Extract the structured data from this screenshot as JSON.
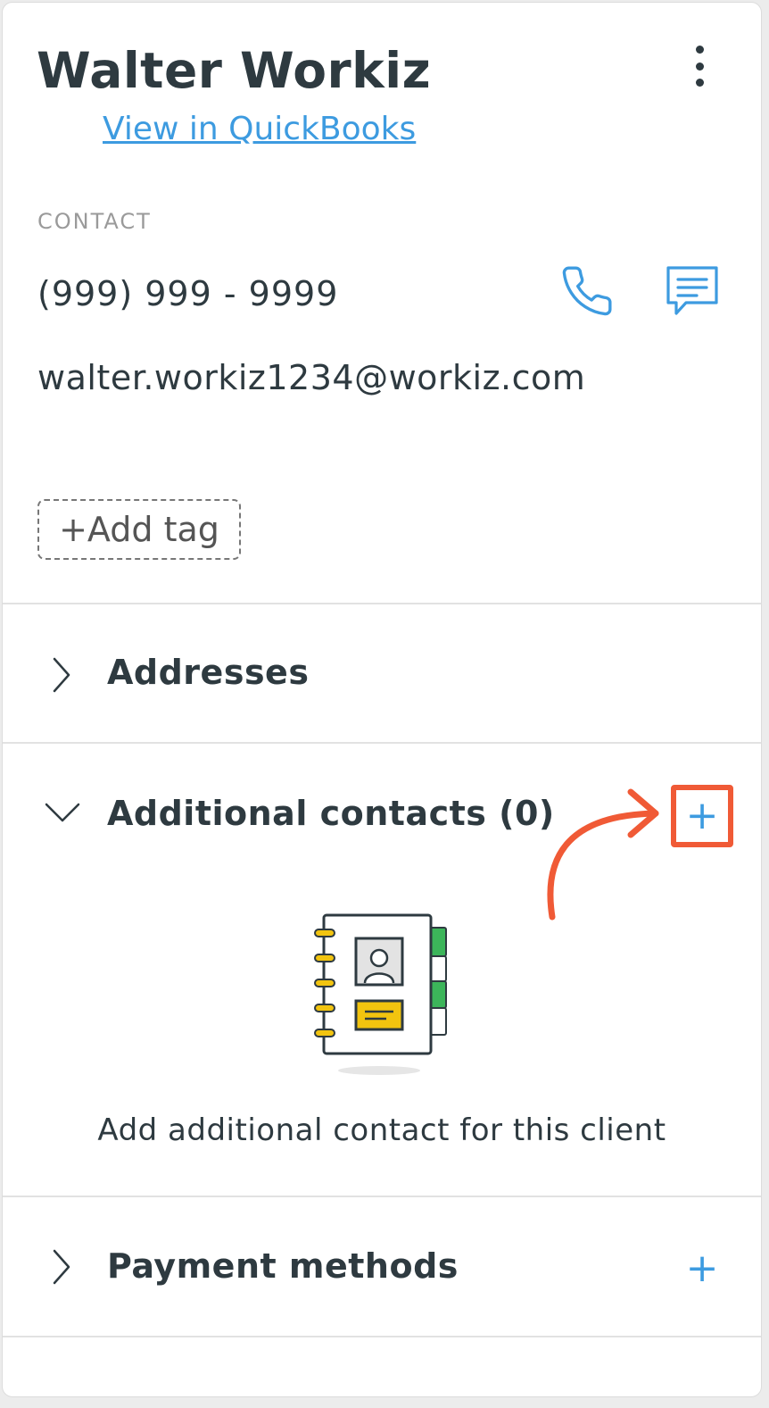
{
  "client": {
    "name": "Walter Workiz",
    "quickbooks_link": "View in QuickBooks",
    "more_menu_icon": "kebab-icon"
  },
  "contact": {
    "heading": "CONTACT",
    "phone": "(999) 999 - 9999",
    "email": "walter.workiz1234@workiz.com",
    "call_icon": "phone-icon",
    "message_icon": "message-icon"
  },
  "tags": {
    "add_label": "+Add tag"
  },
  "sections": {
    "addresses": {
      "title": "Addresses",
      "expanded": false
    },
    "additional_contacts": {
      "title": "Additional contacts (0)",
      "expanded": true,
      "empty_text": "Add additional contact for this client"
    },
    "payment_methods": {
      "title": "Payment methods",
      "expanded": false
    }
  },
  "colors": {
    "accent": "#3d9be0",
    "text": "#2e3a40",
    "muted": "#9a9a9a",
    "annotation": "#f05a36",
    "illustration_yellow": "#f2c40f",
    "illustration_green": "#3cb55a"
  }
}
